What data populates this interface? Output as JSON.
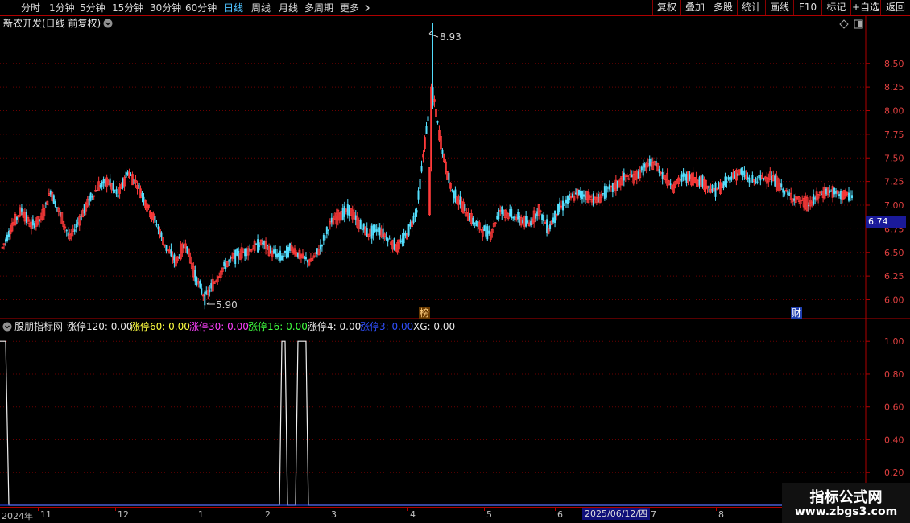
{
  "period_tabs": [
    "分时",
    "1分钟",
    "5分钟",
    "15分钟",
    "30分钟",
    "60分钟",
    "日线",
    "周线",
    "月线",
    "多周期",
    "更多"
  ],
  "active_period": "日线",
  "toolbar_buttons": [
    "复权",
    "叠加",
    "多股",
    "统计",
    "画线",
    "F10",
    "标记",
    "+自选",
    "返回"
  ],
  "stock_title": "新农开发(日线 前复权)",
  "price_axis": {
    "min": 5.8,
    "max": 9.0,
    "ticks": [
      "8.50",
      "8.25",
      "8.00",
      "7.75",
      "7.50",
      "7.25",
      "7.00",
      "6.75",
      "6.50",
      "6.25",
      "6.00"
    ]
  },
  "last_price": "6.74",
  "high_label": "8.93",
  "low_label": "5.90",
  "event_badges": {
    "bang": "榜",
    "cai": "财"
  },
  "indicator": {
    "name": "股朋指标网",
    "items": [
      {
        "label": "涨停120: 0.00",
        "color": "#e8e8e8"
      },
      {
        "label": "涨停60: 0.00",
        "color": "#ffff40"
      },
      {
        "label": "涨停30: 0.00",
        "color": "#ff40ff"
      },
      {
        "label": "涨停16: 0.00",
        "color": "#40ff40"
      },
      {
        "label": "涨停4: 0.00",
        "color": "#e8e8e8"
      },
      {
        "label": "涨停3: 0.00",
        "color": "#3050ff"
      },
      {
        "label": "XG: 0.00",
        "color": "#e8e8e8"
      }
    ],
    "axis_ticks": [
      "1.00",
      "0.80",
      "0.60",
      "0.40",
      "0.20"
    ]
  },
  "x_axis": {
    "labels": [
      "2024年",
      "11",
      "12",
      "1",
      "2",
      "3",
      "4",
      "5",
      "6",
      "7",
      "8"
    ],
    "cursor_date": "2025/06/12/四"
  },
  "watermark": {
    "title": "指标公式网",
    "url": "www.zbgs3.com"
  },
  "chart_data": {
    "type": "candlestick",
    "title": "新农开发(日线 前复权)",
    "ylim": [
      5.8,
      9.0
    ],
    "high": 8.93,
    "low": 5.9,
    "last": 6.74,
    "indicator_series": {
      "name": "XG",
      "ylim": [
        0,
        1.05
      ],
      "pulses": [
        {
          "from": 0,
          "to": 2,
          "value": 1
        },
        {
          "from": 174,
          "to": 176,
          "value": 1
        },
        {
          "from": 184,
          "to": 189,
          "value": 1
        }
      ]
    }
  }
}
